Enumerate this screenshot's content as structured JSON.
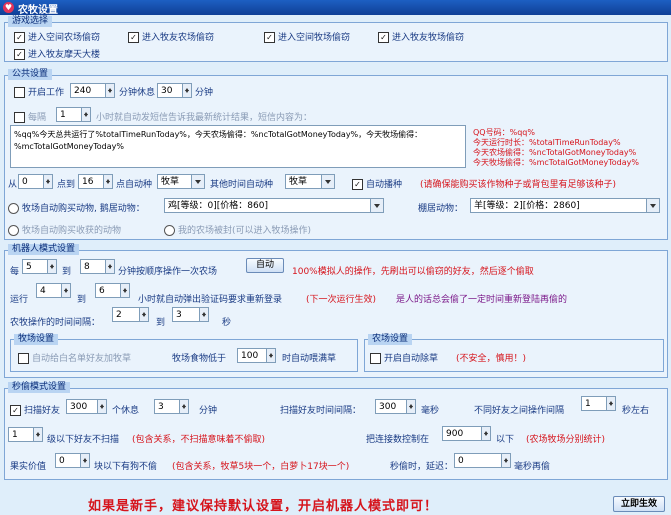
{
  "window": {
    "title": "农牧设置"
  },
  "game_select": {
    "legend": "游戏选择",
    "options": [
      {
        "label": "进入空间农场偷窃",
        "checked": true
      },
      {
        "label": "进入牧友农场偷窃",
        "checked": true
      },
      {
        "label": "进入空间牧场偷窃",
        "checked": true
      },
      {
        "label": "进入牧友牧场偷窃",
        "checked": true
      },
      {
        "label": "进入牧友摩天大楼",
        "checked": true
      }
    ]
  },
  "public": {
    "legend": "公共设置",
    "work_label": "开启工作",
    "work_minutes": "240",
    "rest_label": "分钟休息",
    "rest_minutes": "30",
    "minute_unit": "分钟",
    "every_label": "每隔",
    "every_hours": "1",
    "sms_label": "小时就自动发短信告诉我最新统计结果，短信内容为：",
    "sms_text": "%qq%今天总共运行了%totalTimeRunToday%，今天农场偷得：%ncTotalGotMoneyToday%，今天牧场偷得：%mcTotalGotMoneyToday%",
    "vars": [
      "QQ号码：%qq%",
      "今天运行时长：%totalTimeRunToday%",
      "今天农场偷得：%ncTotalGotMoneyToday%",
      "今天牧场偷得：%mcTotalGotMoneyToday%"
    ],
    "from_label": "从",
    "from_value": "0",
    "to_label": "点到",
    "to_value": "16",
    "auto_plant_label": "点自动种",
    "seed1": "牧草",
    "other_time_label": "其他时间自动种",
    "seed2": "牧草",
    "auto_sow_label": "自动播种",
    "auto_sow_note": "(请确保能购买该作物种子或背包里有足够该种子)",
    "buy_animal_label": "牧场自动购买动物, 鹅居动物：",
    "buy_animal_value": "鸡[等级：0][价格：860]",
    "shed_label": "棚居动物：",
    "shed_value": "羊[等级：2][价格：2860]",
    "buy_harvest_label": "牧场自动购买收获的动物",
    "farm_stolen_label": "我的农场被封(可以进入牧场操作)"
  },
  "robot": {
    "legend": "机器人模式设置",
    "every_label": "每",
    "min_value": "5",
    "to_label": "到",
    "max_value": "8",
    "one_op_label": "分钟按顺序操作一次农场",
    "auto_button": "自动",
    "sim_note": "100%模拟人的操作，先刷出可以偷窃的好友，然后逐个偷取",
    "run_label": "运行",
    "run_min": "4",
    "run_max": "6",
    "verify_label": "小时就自动弹出验证码要求重新登录",
    "next_note": "(下一次运行生效)",
    "human_note": "是人的话总会偷了一定时间重新登陆再偷的",
    "interval_label": "农牧操作的时间间隔：",
    "interval_min": "2",
    "interval_max": "3",
    "second_unit": "秒",
    "pasture": {
      "legend": "牧场设置",
      "whitelist_label": "自动给白名单好友加牧草",
      "food_label": "牧场食物低于",
      "food_value": "100",
      "feed_label": "时自动喂满草"
    },
    "farm": {
      "legend": "农场设置",
      "auto_weed_label": "开启自动除草",
      "unsafe_note": "(不安全，慎用！)"
    }
  },
  "flash": {
    "legend": "秒偷模式设置",
    "scan_label": "扫描好友",
    "scan_value": "300",
    "rest_label": "个休息",
    "rest_value": "3",
    "minute_unit": "分钟",
    "scan_interval_label": "扫描好友时间间隔：",
    "scan_interval_value": "300",
    "ms_unit": "毫秒",
    "op_interval_label": "不同好友之间操作间隔",
    "op_interval_value": "1",
    "approx_sec": "秒左右",
    "level_value": "1",
    "level_label": "级以下好友不扫描",
    "level_note": "(包含关系，不扫描意味着不偷取)",
    "connect_label": "把连接数控制在",
    "connect_value": "900",
    "below_label": "以下",
    "connect_note": "(农场牧场分别统计)",
    "fruit_label": "果实价值",
    "fruit_value": "0",
    "fruit_below_label": "块以下有狗不偷",
    "fruit_note": "(包含关系，牧草5块一个，白萝卜17块一个)",
    "delay_label": "秒偷时，延迟：",
    "delay_value": "0",
    "delay_unit": "毫秒再偷"
  },
  "footer": {
    "tip": "如果是新手，建议保持默认设置，开启机器人模式即可！",
    "apply_button": "立即生效"
  }
}
